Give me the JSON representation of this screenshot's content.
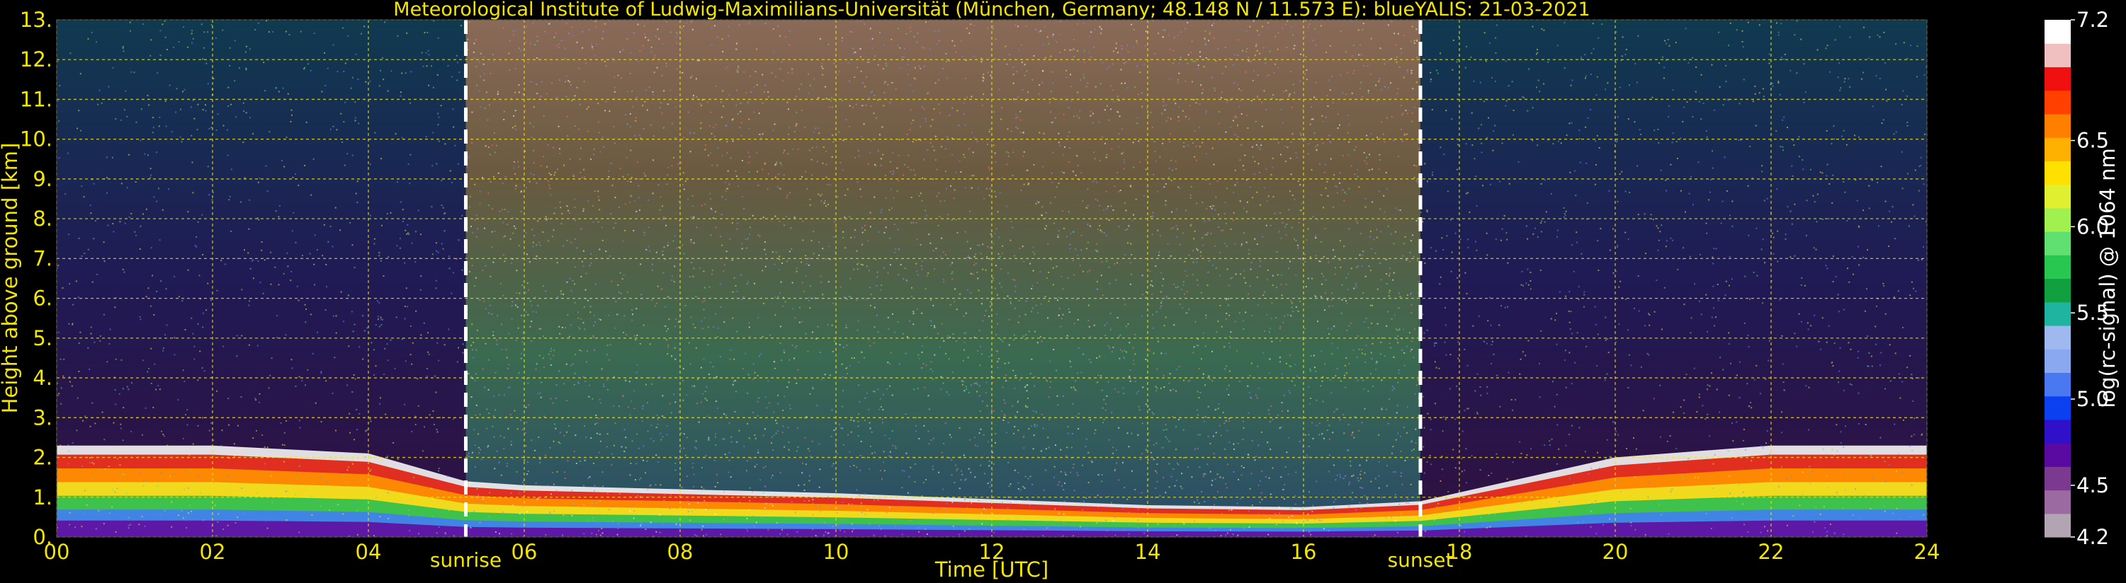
{
  "chart_data": {
    "type": "heatmap",
    "title": "Meteorological Institute of Ludwig-Maximilians-Universität (München, Germany; 48.148 N / 11.573 E):     blueYALIS: 21-03-2021",
    "xlabel": "Time [UTC]",
    "ylabel": "Height above ground [km]",
    "xlim": [
      0,
      24
    ],
    "ylim": [
      0,
      13
    ],
    "x_ticks": [
      "00",
      "02",
      "04",
      "06",
      "08",
      "10",
      "12",
      "14",
      "16",
      "18",
      "20",
      "22",
      "24"
    ],
    "y_ticks": [
      "0.",
      "1.",
      "2.",
      "3.",
      "4.",
      "5.",
      "6.",
      "7.",
      "8.",
      "9.",
      "10.",
      "11.",
      "12.",
      "13."
    ],
    "grid": true,
    "annotations": [
      {
        "label": "sunrise",
        "x": 5.25
      },
      {
        "label": "sunset",
        "x": 17.5
      }
    ],
    "colorbar": {
      "label": "log(rc-signal) @ 1064 nm",
      "range": [
        4.2,
        7.2
      ],
      "ticks": [
        "7.2",
        "6.5",
        "6.0",
        "5.5",
        "5.0",
        "4.5",
        "4.2"
      ],
      "tick_values": [
        7.2,
        6.5,
        6.0,
        5.5,
        5.0,
        4.5,
        4.2
      ]
    },
    "features": {
      "boundary_layer_top_km": [
        [
          0,
          2.3
        ],
        [
          2,
          2.3
        ],
        [
          4,
          2.1
        ],
        [
          5.25,
          1.4
        ],
        [
          6,
          1.3
        ],
        [
          8,
          1.2
        ],
        [
          10,
          1.1
        ],
        [
          12,
          0.95
        ],
        [
          14,
          0.8
        ],
        [
          16,
          0.75
        ],
        [
          17.5,
          0.9
        ],
        [
          20,
          2.0
        ],
        [
          22,
          2.3
        ],
        [
          24,
          2.3
        ]
      ]
    }
  },
  "colors": {
    "background": "#000000",
    "text": "#f2e600",
    "grid": "#f2e600",
    "colorbar_text": "#ffffff",
    "colormap": [
      "#b2a4b2",
      "#9b6aa0",
      "#7b3a90",
      "#5a0aa0",
      "#3010c8",
      "#0a40f0",
      "#4a78f0",
      "#8aa8f0",
      "#a0b8f0",
      "#1eb4a0",
      "#10a040",
      "#28c850",
      "#60e070",
      "#a0f050",
      "#e0f030",
      "#ffe000",
      "#ffb000",
      "#ff8000",
      "#ff4000",
      "#f01010",
      "#f0c0c0",
      "#ffffff"
    ]
  }
}
